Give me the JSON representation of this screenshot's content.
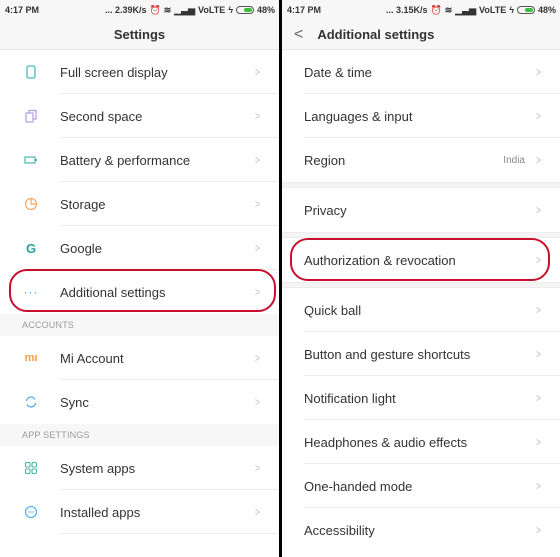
{
  "left": {
    "status": {
      "time": "4:17 PM",
      "speed": "... 2.39K/s",
      "network": "VoLTE",
      "battery": "48%"
    },
    "title": "Settings",
    "items_top": [
      {
        "label": "Full screen display",
        "icon": "phone-screen-icon"
      },
      {
        "label": "Second space",
        "icon": "second-space-icon"
      },
      {
        "label": "Battery & performance",
        "icon": "battery-icon"
      },
      {
        "label": "Storage",
        "icon": "storage-pie-icon"
      },
      {
        "label": "Google",
        "icon": "google-icon"
      },
      {
        "label": "Additional settings",
        "icon": "more-dots-icon",
        "highlighted": true
      }
    ],
    "sections": [
      {
        "header": "ACCOUNTS",
        "items": [
          {
            "label": "Mi Account",
            "icon": "mi-icon"
          },
          {
            "label": "Sync",
            "icon": "sync-icon"
          }
        ]
      },
      {
        "header": "APP SETTINGS",
        "items": [
          {
            "label": "System apps",
            "icon": "grid-apps-icon"
          },
          {
            "label": "Installed apps",
            "icon": "installed-apps-icon"
          }
        ]
      }
    ]
  },
  "right": {
    "status": {
      "time": "4:17 PM",
      "speed": "... 3.15K/s",
      "network": "VoLTE",
      "battery": "48%"
    },
    "title": "Additional settings",
    "groups": [
      [
        {
          "label": "Date & time"
        },
        {
          "label": "Languages & input"
        },
        {
          "label": "Region",
          "value": "India"
        }
      ],
      [
        {
          "label": "Privacy"
        }
      ],
      [
        {
          "label": "Authorization & revocation",
          "highlighted": true
        }
      ],
      [
        {
          "label": "Quick ball"
        },
        {
          "label": "Button and gesture shortcuts"
        },
        {
          "label": "Notification light"
        },
        {
          "label": "Headphones & audio effects"
        },
        {
          "label": "One-handed mode"
        },
        {
          "label": "Accessibility"
        }
      ]
    ]
  },
  "colors": {
    "highlight": "#c8102e",
    "accent_teal": "#4db6ac",
    "accent_orange": "#f0a868",
    "battery_green": "#3cbf3c"
  }
}
